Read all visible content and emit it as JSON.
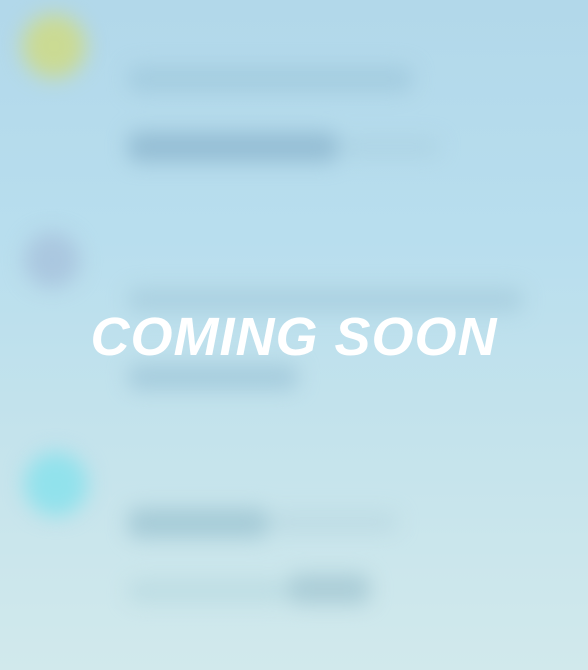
{
  "overlay": {
    "text": "COMING SOON"
  },
  "colors": {
    "background_top": "#b2d8ea",
    "background_bottom": "#d1e9ec",
    "overlay_text": "#ffffff",
    "avatar_1": "#c9d88a",
    "avatar_2": "#a9c6df",
    "avatar_3": "#8fe0ea"
  },
  "list": {
    "items": [
      {
        "avatar_icon": "avatar-placeholder"
      },
      {
        "avatar_icon": "avatar-placeholder"
      },
      {
        "avatar_icon": "avatar-placeholder"
      }
    ]
  }
}
